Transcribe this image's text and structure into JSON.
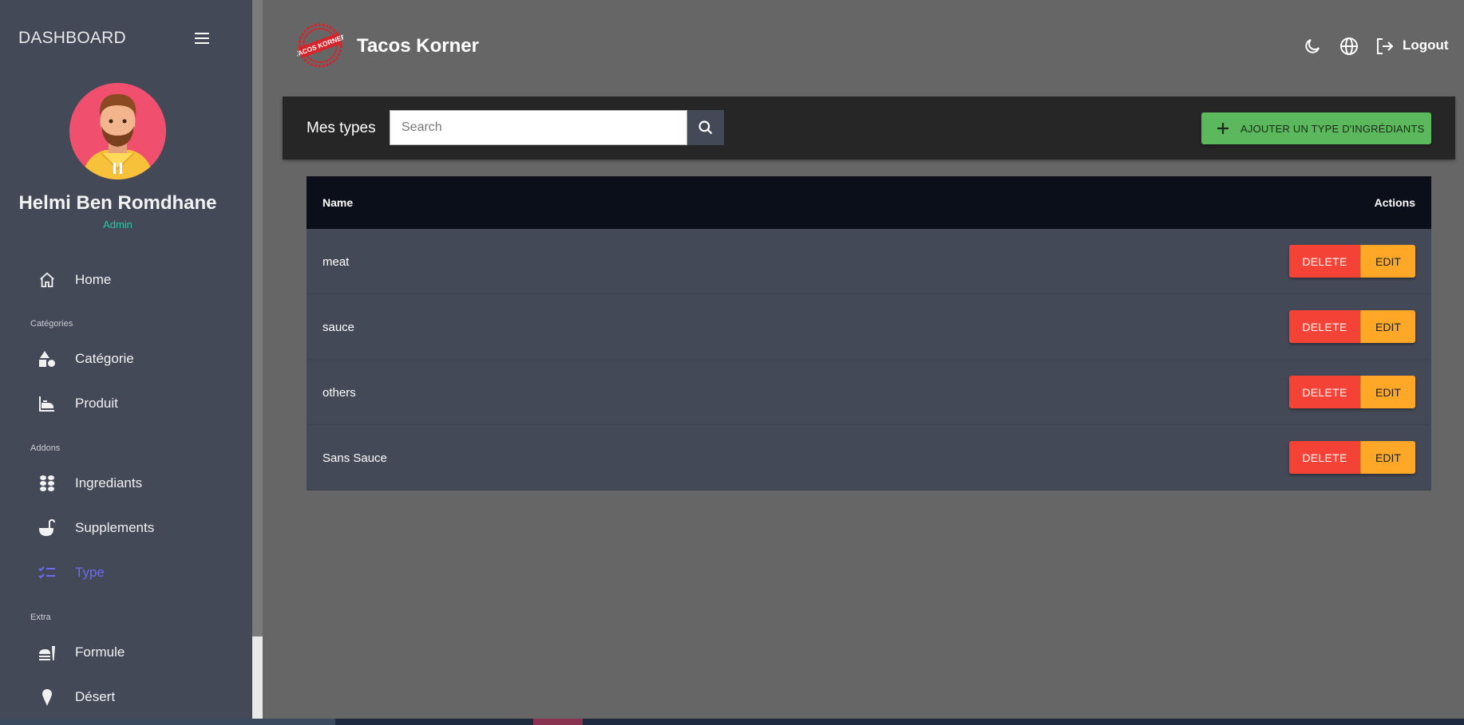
{
  "sidebar": {
    "title": "DASHBOARD",
    "user": {
      "name": "Helmi Ben Romdhane",
      "role": "Admin"
    },
    "items": [
      {
        "label": "Home",
        "icon": "home-icon"
      },
      {
        "section": "Catégories"
      },
      {
        "label": "Catégorie",
        "icon": "shapes-icon"
      },
      {
        "label": "Produit",
        "icon": "product-icon"
      },
      {
        "section": "Addons"
      },
      {
        "label": "Ingrediants",
        "icon": "ingredients-icon"
      },
      {
        "label": "Supplements",
        "icon": "ladle-icon"
      },
      {
        "label": "Type",
        "icon": "checklist-icon",
        "active": true
      },
      {
        "section": "Extra"
      },
      {
        "label": "Formule",
        "icon": "fastfood-icon"
      },
      {
        "label": "Désert",
        "icon": "icecream-icon"
      }
    ]
  },
  "header": {
    "app_title": "Tacos Korner",
    "logo_text": "TACOS KORNER",
    "logout_label": "Logout"
  },
  "toolbar": {
    "title": "Mes types",
    "search_placeholder": "Search",
    "add_label": "AJOUTER UN TYPE D'INGRÉDIANTS"
  },
  "table": {
    "columns": [
      "Name",
      "Actions"
    ],
    "rows": [
      {
        "name": "meat"
      },
      {
        "name": "sauce"
      },
      {
        "name": "others"
      },
      {
        "name": "Sans Sauce"
      }
    ],
    "delete_label": "DELETE",
    "edit_label": "EDIT"
  },
  "colors": {
    "sidebar_bg": "#444957",
    "page_bg": "#666666",
    "active_nav": "#6b6cf0",
    "role": "#2ec4a6",
    "add_button": "#5cb85c",
    "delete_button": "#f44336",
    "edit_button": "#ffa726"
  }
}
